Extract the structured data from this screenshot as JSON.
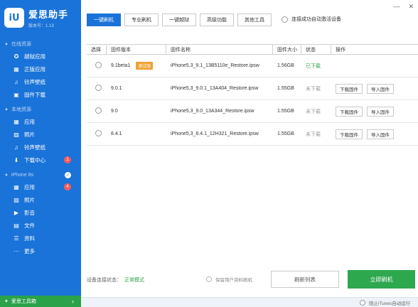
{
  "app": {
    "name": "爱思助手",
    "version": "版本号：1.13",
    "logo_text": "iU"
  },
  "window": {
    "minimize": "—",
    "close": "✕"
  },
  "sidebar": {
    "online_section": "在线资源",
    "online_items": [
      {
        "label": "越狱应用",
        "icon": "jailbreak-apps-icon"
      },
      {
        "label": "正版应用",
        "icon": "apps-icon"
      },
      {
        "label": "铃声壁纸",
        "icon": "ringtone-icon"
      },
      {
        "label": "固件下载",
        "icon": "firmware-icon"
      }
    ],
    "local_section": "本地资源",
    "local_items": [
      {
        "label": "应用",
        "icon": "apps-icon"
      },
      {
        "label": "照片",
        "icon": "photos-icon"
      },
      {
        "label": "铃声壁纸",
        "icon": "ringtone-icon"
      },
      {
        "label": "下载中心",
        "icon": "download-icon",
        "badge": "1"
      }
    ],
    "device_section": "iPhone 8s",
    "device_items": [
      {
        "label": "应用",
        "icon": "apps-icon",
        "badge": "4"
      },
      {
        "label": "照片",
        "icon": "photos-icon"
      },
      {
        "label": "影音",
        "icon": "media-icon"
      },
      {
        "label": "文件",
        "icon": "files-icon"
      },
      {
        "label": "资料",
        "icon": "data-icon"
      },
      {
        "label": "更多",
        "icon": "more-icon"
      }
    ],
    "footer": "爱思工具箱"
  },
  "tabs": [
    {
      "label": "一键刷机",
      "active": true
    },
    {
      "label": "专业刷机",
      "active": false
    },
    {
      "label": "一键越狱",
      "active": false
    },
    {
      "label": "高级功能",
      "active": false
    },
    {
      "label": "其他工具",
      "active": false
    }
  ],
  "auto_activate_label": "连接成功自动激活设备",
  "table": {
    "headers": [
      "选择",
      "固件版本",
      "固件名称",
      "固件大小",
      "状态",
      "操作"
    ],
    "rows": [
      {
        "version": "9.1beta1",
        "tag": "测试版",
        "name": "iPhone5,3_9.1_13B5110e_Restore.ipsw",
        "size": "1.56GB",
        "status": "已下载",
        "downloaded": true,
        "ops": []
      },
      {
        "version": "9.0.1",
        "tag": "",
        "name": "iPhone5,3_9.0.1_13A404_Restore.ipsw",
        "size": "1.55GB",
        "status": "未下载",
        "downloaded": false,
        "ops": [
          "下载固件",
          "导入固件"
        ]
      },
      {
        "version": "9.0",
        "tag": "",
        "name": "iPhone5,3_9.0_13A344_Restore.ipsw",
        "size": "1.55GB",
        "status": "未下载",
        "downloaded": false,
        "ops": [
          "下载固件",
          "导入固件"
        ]
      },
      {
        "version": "8.4.1",
        "tag": "",
        "name": "iPhone5,3_8.4.1_12H321_Restore.ipsw",
        "size": "1.55GB",
        "status": "未下载",
        "downloaded": false,
        "ops": [
          "下载固件",
          "导入固件"
        ]
      }
    ]
  },
  "bottom": {
    "conn_label": "设备连接状态：",
    "conn_value": "正常模式",
    "keep_data": "保留用户资料刷机",
    "refresh": "刷新列表",
    "flash": "立即刷机"
  },
  "status_bar": {
    "itunes": "阻止iTunes自动运行"
  },
  "colors": {
    "primary": "#1a73d8",
    "success": "#2ea84e",
    "warning": "#f0a030",
    "badge": "#ff5a5a"
  }
}
